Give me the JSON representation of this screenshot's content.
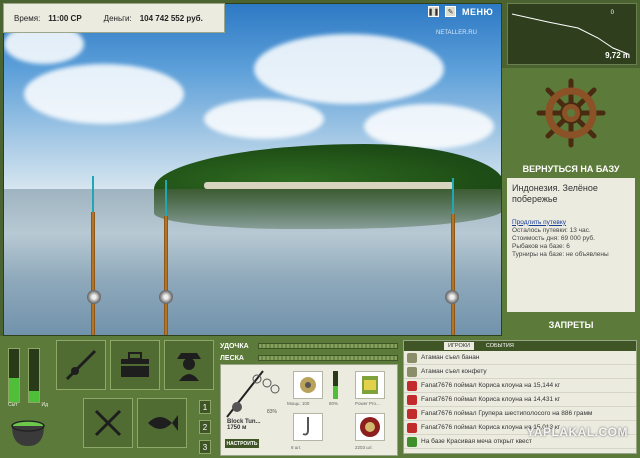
{
  "infobar": {
    "time_label": "Время:",
    "time_value": "11:00 СР",
    "money_label": "Деньги:",
    "money_value": "104 742 552 руб."
  },
  "top": {
    "menu_label": "МЕНЮ",
    "watermark": "NETALLER.RU"
  },
  "minimap": {
    "zero_label": "0",
    "depth": "9,72 m"
  },
  "right_panel": {
    "base_button": "ВЕРНУТЬСЯ НА БАЗУ",
    "location_title": "Индонезия. Зелёное побережье",
    "extend_link": "Продлить путевку",
    "lines": [
      "Осталось путевки: 13 час.",
      "Стоимость дня: 69 000 руб.",
      "Рыбаков на базе: 6",
      "Турниры на базе: не объявлены"
    ],
    "bans_button": "ЗАПРЕТЫ"
  },
  "bottom": {
    "gauge_labels": [
      "Сыт",
      "Ид"
    ],
    "gauge_levels": [
      0.45,
      0.2
    ],
    "numbers": [
      "1",
      "2",
      "3"
    ],
    "rod_label": "УДОЧКА",
    "line_label": "ЛЕСКА",
    "rod_name": "Block Tun...",
    "rod_length": "1750 м",
    "rod_pct": "83%",
    "slot_labels": [
      "Мощь: 100",
      "80%",
      "Power Pro...",
      "8 шт.",
      "2203 шт."
    ],
    "tune_button": "НАСТРОИТЬ"
  },
  "events": {
    "tabs": [
      "ИГРОКИ",
      "СОБЫТИЯ"
    ],
    "rows": [
      {
        "text": "Атаман съел банан",
        "color": "#8a8f6a"
      },
      {
        "text": "Атаман съел конфету",
        "color": "#8a8f6a"
      },
      {
        "text": "Fanat7676 поймал Кориса клоуна на 15,144 кг",
        "color": "#c22b2b"
      },
      {
        "text": "Fanat7676 поймал Кориса клоуна на 14,431 кг",
        "color": "#c22b2b"
      },
      {
        "text": "Fanat7676 поймал Групера шестиполосого на 886 грамм",
        "color": "#c22b2b"
      },
      {
        "text": "Fanat7676 поймал Кориса клоуна на 15,013 кг",
        "color": "#c22b2b"
      },
      {
        "text": "На базе Красивая меча открыт квест",
        "color": "#3f8f2a"
      }
    ],
    "watermark": "YAPLAKAL.COM"
  }
}
